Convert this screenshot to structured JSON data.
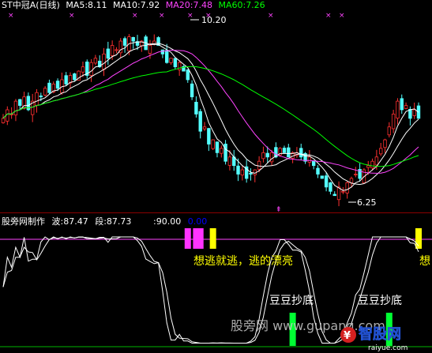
{
  "upper_panel": {
    "legend": [
      {
        "text": "ST中冠A(日线)",
        "color": "#ffffff"
      },
      {
        "text": "MA5:8.11",
        "color": "#ffffff"
      },
      {
        "text": "MA10:7.92",
        "color": "#ffffff"
      },
      {
        "text": "MA20:7.48",
        "color": "#ff44ff"
      },
      {
        "text": "MA60:7.26",
        "color": "#00ff00"
      }
    ],
    "high_label": "10.20",
    "low_label": "6.25"
  },
  "lower_panel": {
    "legend": [
      {
        "text": "股旁网制作",
        "color": "#ffffff"
      },
      {
        "text": "波:87.47",
        "color": "#ffffff"
      },
      {
        "text": "段:87.73",
        "color": "#ffffff"
      },
      {
        "text": ":90.00",
        "color": "#ffffff"
      },
      {
        "text": "0.00",
        "color": "#0000ff"
      }
    ],
    "annotations": {
      "escape": "想逃就逃，逃的漂亮",
      "escape_right": "想",
      "bottom1": "豆豆抄底",
      "bottom2": "豆豆抄底"
    },
    "watermark": "股旁网 www.gupang.com",
    "logo": {
      "main": "智股网",
      "sub": "raiyue.com"
    }
  },
  "chart_data": [
    {
      "type": "candlestick",
      "title": "ST中冠A(日线)",
      "price_marks": {
        "high": 10.2,
        "low": 6.25
      },
      "series": [
        {
          "name": "MA5",
          "last_value": 8.11,
          "color": "#ffffff"
        },
        {
          "name": "MA10",
          "last_value": 7.92,
          "color": "#ffffff"
        },
        {
          "name": "MA20",
          "last_value": 7.48,
          "color": "#ff44ff"
        },
        {
          "name": "MA60",
          "last_value": 7.26,
          "color": "#00ff00"
        }
      ],
      "up_color": "#ff3030",
      "down_color": "#54ffff",
      "closes": [
        8.1,
        8.3,
        8.2,
        8.5,
        8.4,
        8.6,
        8.3,
        8.5,
        8.7,
        8.6,
        8.8,
        8.7,
        8.9,
        8.8,
        9.0,
        8.9,
        9.1,
        9.0,
        9.2,
        9.3,
        9.1,
        9.4,
        9.5,
        9.3,
        9.6,
        9.5,
        9.8,
        9.7,
        9.9,
        9.8,
        10.0,
        9.9,
        9.8,
        9.9,
        9.7,
        9.8,
        9.9,
        9.8,
        9.6,
        9.4,
        9.5,
        9.3,
        9.4,
        9.2,
        9.0,
        8.6,
        8.2,
        7.8,
        7.9,
        7.5,
        7.6,
        7.3,
        7.4,
        7.1,
        7.2,
        7.0,
        6.8,
        6.9,
        6.7,
        6.8,
        6.9,
        7.1,
        7.3,
        7.2,
        7.3,
        7.2,
        7.4,
        7.3,
        7.2,
        7.3,
        7.3,
        7.2,
        7.1,
        7.2,
        7.0,
        6.8,
        6.7,
        6.5,
        6.4,
        6.3,
        6.5,
        6.4,
        6.6,
        6.7,
        6.8,
        6.7,
        6.9,
        7.0,
        7.1,
        7.2,
        7.4,
        7.6,
        7.9,
        8.2,
        8.5,
        8.3,
        8.4,
        8.1,
        8.3,
        8.1
      ]
    },
    {
      "type": "line",
      "title": "股旁网制作",
      "series": [
        {
          "name": "波",
          "last_value": 87.47,
          "color": "#ffffff"
        },
        {
          "name": "段",
          "last_value": 87.73,
          "color": "#ffffff"
        }
      ],
      "reference_lines": [
        90,
        0
      ],
      "escape_bars": {
        "magenta": [
          44,
          46,
          47
        ],
        "yellow": [
          50,
          99
        ]
      },
      "bottom_bars": [
        69,
        92
      ]
    }
  ]
}
